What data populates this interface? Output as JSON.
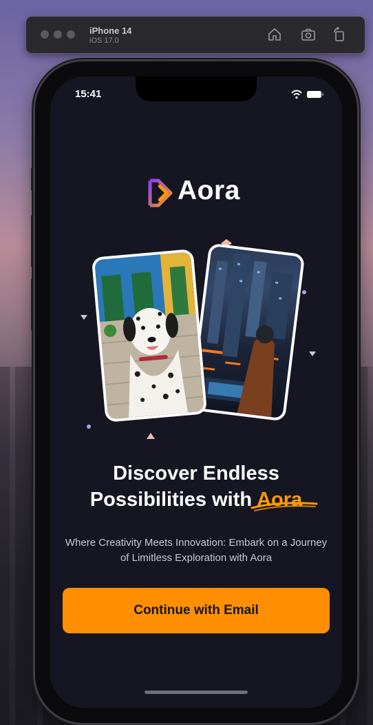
{
  "simulator": {
    "device_name": "iPhone 14",
    "os_version": "iOS 17.0",
    "toolbar_icons": [
      "home-icon",
      "screenshot-icon",
      "rotate-icon"
    ]
  },
  "status_bar": {
    "time": "15:41",
    "icons": [
      "wifi-icon",
      "battery-icon"
    ]
  },
  "app": {
    "logo_text": "Aora",
    "headline_part1": "Discover Endless",
    "headline_part2": "Possibilities with",
    "headline_accent": "Aora",
    "subtext": "Where Creativity Meets Innovation: Embark on a Journey of Limitless Exploration with Aora",
    "cta_label": "Continue with Email"
  },
  "images": [
    "dalmatian-photo",
    "cyberpunk-city-photo"
  ],
  "colors": {
    "background": "#161622",
    "accent": "#FF9C01",
    "logo_gradient_start": "#8A3FFC",
    "logo_gradient_end": "#FF9A00"
  }
}
